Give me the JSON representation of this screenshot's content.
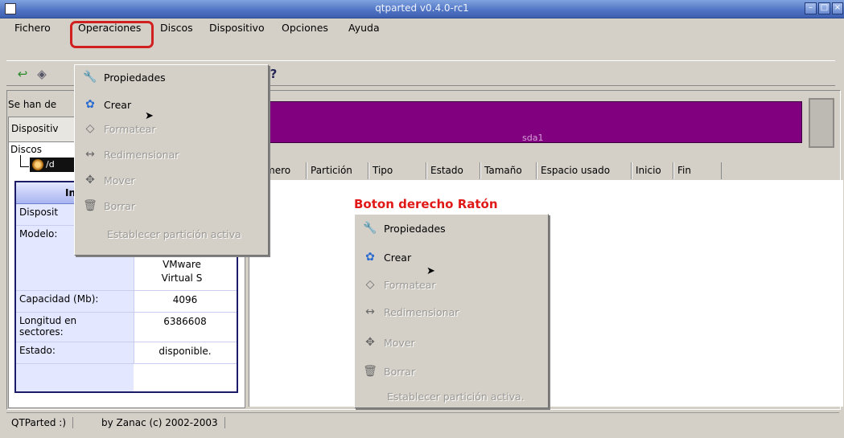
{
  "window": {
    "title": "qtparted v0.4.0-rc1"
  },
  "menubar": {
    "items": [
      "Fichero",
      "Operaciones",
      "Discos",
      "Dispositivo",
      "Opciones",
      "Ayuda"
    ]
  },
  "toolbar": {
    "icons": [
      "back-arrow-icon",
      "disk-icon",
      "help-icon"
    ]
  },
  "status_message": "Se han de",
  "device_box": "Dispositiv",
  "tree": {
    "root": "Discos",
    "selected": "/d"
  },
  "info_panel": {
    "header": "In",
    "rows": [
      {
        "key": "Disposit",
        "value": ""
      },
      {
        "key": "Modelo:",
        "value": "VMware Virtual S"
      },
      {
        "key": "Capacidad (Mb):",
        "value": "4096"
      },
      {
        "key": "Longitud en sectores:",
        "value": "6386608"
      },
      {
        "key": "Estado:",
        "value": "disponible."
      }
    ]
  },
  "partition_bar": {
    "label": "sda1",
    "color": "#800080"
  },
  "table_headers": [
    "mero",
    "Partición",
    "Tipo",
    "Estado",
    "Tamaño",
    "Espacio usado",
    "Inicio",
    "Fin"
  ],
  "context_label": "Boton derecho Ratón",
  "menu_items": [
    {
      "label": "Propiedades",
      "icon": "wrench-icon",
      "enabled": true
    },
    {
      "label": "Crear",
      "icon": "create-icon",
      "enabled": true
    },
    {
      "label": "Formatear",
      "icon": "eraser-icon",
      "enabled": false
    },
    {
      "label": "Redimensionar",
      "icon": "resize-icon",
      "enabled": false
    },
    {
      "label": "Mover",
      "icon": "move-icon",
      "enabled": false
    },
    {
      "label": "Borrar",
      "icon": "trash-icon",
      "enabled": false
    },
    {
      "label": "Establecer partición activa",
      "icon": "",
      "enabled": false
    }
  ],
  "dropdown_last_item": "Establecer partición activa",
  "context_last_item": "Establecer partición activa.",
  "statusbar": {
    "left": "QTParted :)",
    "right": "by Zanac (c) 2002-2003"
  },
  "colors": {
    "title_bar": "#4f72c2",
    "highlight": "#d02020",
    "partition": "#800080"
  }
}
